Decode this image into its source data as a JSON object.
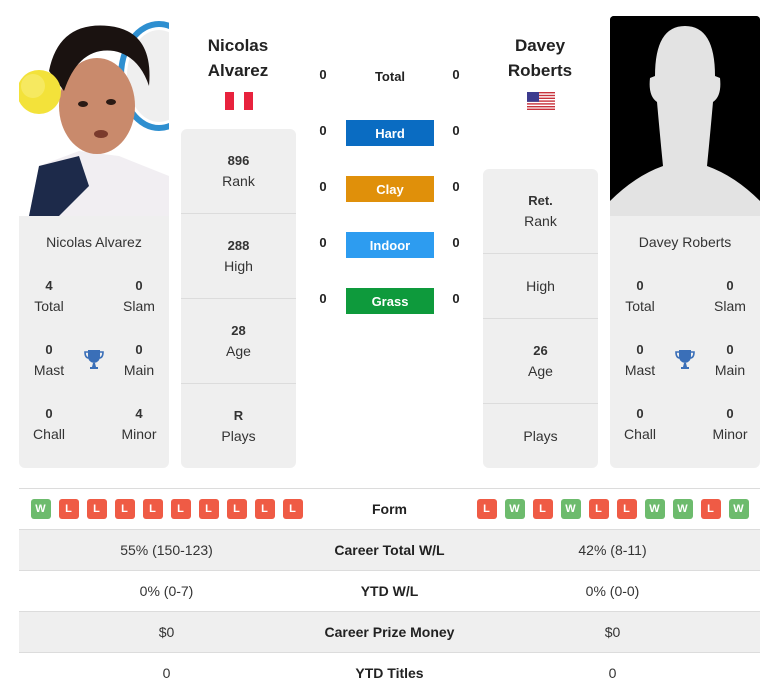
{
  "colors": {
    "hard": "#0a6cc2",
    "clay": "#e0900a",
    "indoor": "#2d9cf0",
    "grass": "#0e9a3c",
    "win": "#6dbb6d",
    "loss": "#ef5b45",
    "trophy": "#3a6fb8"
  },
  "player1": {
    "name_line1": "Nicolas",
    "name_line2": "Alvarez",
    "full_name": "Nicolas Alvarez",
    "flag": "peru-flag",
    "titles": {
      "total": "4",
      "total_label": "Total",
      "slam": "0",
      "slam_label": "Slam",
      "mast": "0",
      "mast_label": "Mast",
      "main": "0",
      "main_label": "Main",
      "chall": "0",
      "chall_label": "Chall",
      "minor": "4",
      "minor_label": "Minor"
    },
    "info": [
      {
        "value": "896",
        "label": "Rank"
      },
      {
        "value": "288",
        "label": "High"
      },
      {
        "value": "28",
        "label": "Age"
      },
      {
        "value": "R",
        "label": "Plays"
      }
    ],
    "form": [
      "W",
      "L",
      "L",
      "L",
      "L",
      "L",
      "L",
      "L",
      "L",
      "L"
    ]
  },
  "player2": {
    "name_line1": "Davey",
    "name_line2": "Roberts",
    "full_name": "Davey Roberts",
    "flag": "usa-flag",
    "titles": {
      "total": "0",
      "total_label": "Total",
      "slam": "0",
      "slam_label": "Slam",
      "mast": "0",
      "mast_label": "Mast",
      "main": "0",
      "main_label": "Main",
      "chall": "0",
      "chall_label": "Chall",
      "minor": "0",
      "minor_label": "Minor"
    },
    "info": [
      {
        "value": "Ret.",
        "label": "Rank"
      },
      {
        "value": "",
        "label": "High"
      },
      {
        "value": "26",
        "label": "Age"
      },
      {
        "value": "",
        "label": "Plays"
      }
    ],
    "form": [
      "L",
      "W",
      "L",
      "W",
      "L",
      "L",
      "W",
      "W",
      "L",
      "W"
    ]
  },
  "h2h": {
    "total": {
      "label": "Total",
      "p1": "0",
      "p2": "0"
    },
    "surfaces": [
      {
        "label": "Hard",
        "p1": "0",
        "p2": "0"
      },
      {
        "label": "Clay",
        "p1": "0",
        "p2": "0"
      },
      {
        "label": "Indoor",
        "p1": "0",
        "p2": "0"
      },
      {
        "label": "Grass",
        "p1": "0",
        "p2": "0"
      }
    ]
  },
  "table": {
    "form_label": "Form",
    "rows": [
      {
        "label": "Career Total W/L",
        "p1": "55% (150-123)",
        "p2": "42% (8-11)"
      },
      {
        "label": "YTD W/L",
        "p1": "0% (0-7)",
        "p2": "0% (0-0)"
      },
      {
        "label": "Career Prize Money",
        "p1": "$0",
        "p2": "$0"
      },
      {
        "label": "YTD Titles",
        "p1": "0",
        "p2": "0"
      }
    ]
  }
}
